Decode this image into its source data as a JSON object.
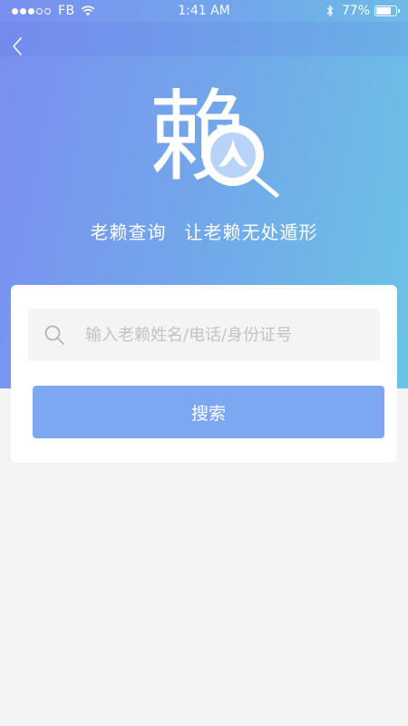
{
  "status_bar": {
    "carrier": "FB",
    "time": "1:41 AM",
    "battery_percent": "77%",
    "battery_level": 0.77,
    "signal_bars_filled": 3,
    "signal_bars_total": 5
  },
  "nav": {
    "back_icon": "chevron-left-icon"
  },
  "logo": {
    "character": "赖",
    "icon": "magnifier-person-icon"
  },
  "slogan": {
    "part1": "老赖查询",
    "part2": "让老赖无处遁形"
  },
  "search": {
    "placeholder": "输入老赖姓名/电话/身份证号",
    "value": "",
    "icon": "search-icon",
    "button_label": "搜索"
  },
  "colors": {
    "gradient_start": "#7a8ff0",
    "gradient_end": "#6bc3e6",
    "button": "#7ea7f2",
    "page_background": "#f4f4f4"
  }
}
